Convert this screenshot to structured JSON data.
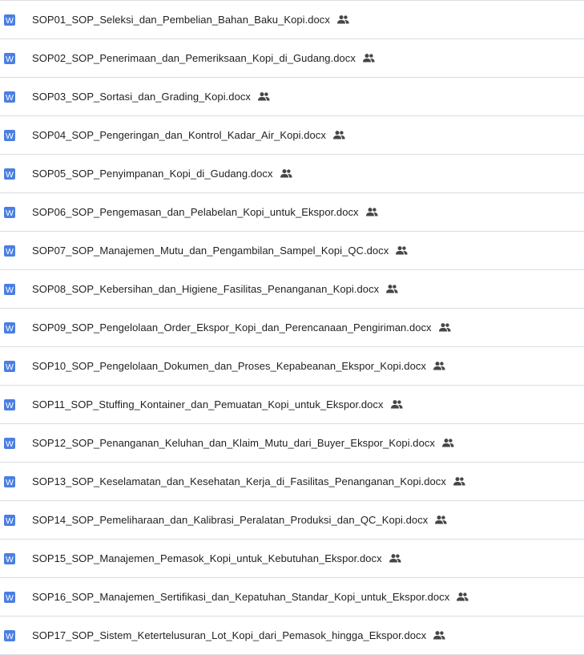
{
  "icons": {
    "file_type": "word-doc-icon",
    "file_type_letter": "W",
    "file_type_color": "#4a7fe3",
    "shared": "people-shared-icon",
    "shared_color": "#444746"
  },
  "files": [
    {
      "name": "SOP01_SOP_Seleksi_dan_Pembelian_Bahan_Baku_Kopi.docx"
    },
    {
      "name": "SOP02_SOP_Penerimaan_dan_Pemeriksaan_Kopi_di_Gudang.docx"
    },
    {
      "name": "SOP03_SOP_Sortasi_dan_Grading_Kopi.docx"
    },
    {
      "name": "SOP04_SOP_Pengeringan_dan_Kontrol_Kadar_Air_Kopi.docx"
    },
    {
      "name": "SOP05_SOP_Penyimpanan_Kopi_di_Gudang.docx"
    },
    {
      "name": "SOP06_SOP_Pengemasan_dan_Pelabelan_Kopi_untuk_Ekspor.docx"
    },
    {
      "name": "SOP07_SOP_Manajemen_Mutu_dan_Pengambilan_Sampel_Kopi_QC.docx"
    },
    {
      "name": "SOP08_SOP_Kebersihan_dan_Higiene_Fasilitas_Penanganan_Kopi.docx"
    },
    {
      "name": "SOP09_SOP_Pengelolaan_Order_Ekspor_Kopi_dan_Perencanaan_Pengiriman.docx"
    },
    {
      "name": "SOP10_SOP_Pengelolaan_Dokumen_dan_Proses_Kepabeanan_Ekspor_Kopi.docx"
    },
    {
      "name": "SOP11_SOP_Stuffing_Kontainer_dan_Pemuatan_Kopi_untuk_Ekspor.docx"
    },
    {
      "name": "SOP12_SOP_Penanganan_Keluhan_dan_Klaim_Mutu_dari_Buyer_Ekspor_Kopi.docx"
    },
    {
      "name": "SOP13_SOP_Keselamatan_dan_Kesehatan_Kerja_di_Fasilitas_Penanganan_Kopi.docx"
    },
    {
      "name": "SOP14_SOP_Pemeliharaan_dan_Kalibrasi_Peralatan_Produksi_dan_QC_Kopi.docx"
    },
    {
      "name": "SOP15_SOP_Manajemen_Pemasok_Kopi_untuk_Kebutuhan_Ekspor.docx"
    },
    {
      "name": "SOP16_SOP_Manajemen_Sertifikasi_dan_Kepatuhan_Standar_Kopi_untuk_Ekspor.docx"
    },
    {
      "name": "SOP17_SOP_Sistem_Ketertelusuran_Lot_Kopi_dari_Pemasok_hingga_Ekspor.docx"
    }
  ]
}
